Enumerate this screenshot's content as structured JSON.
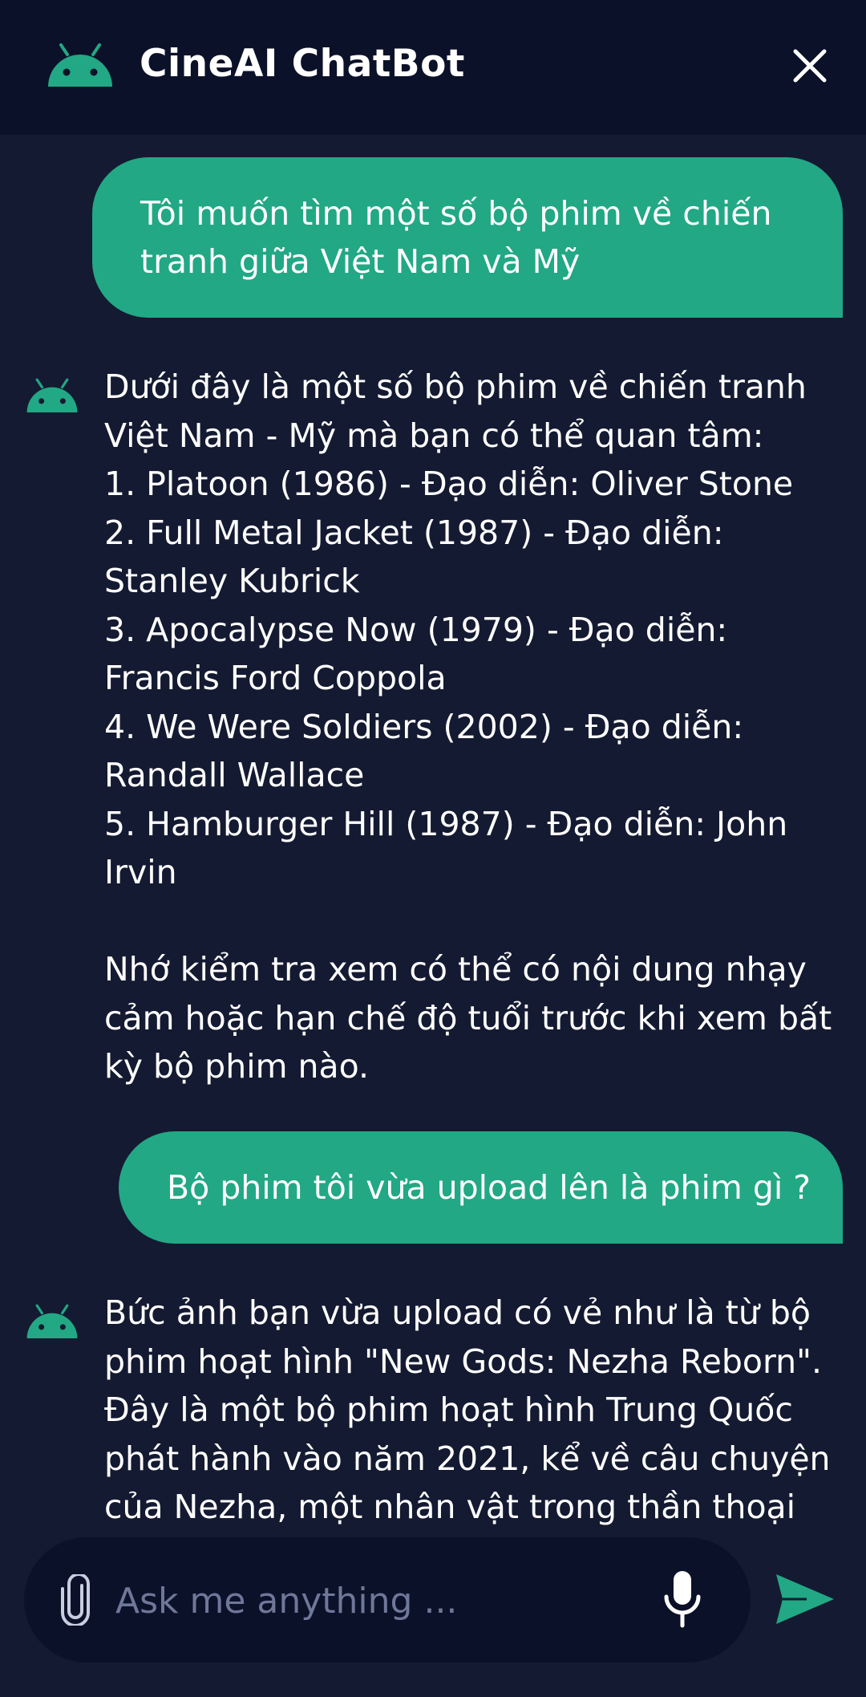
{
  "header": {
    "title": "CineAI ChatBot",
    "bot_icon": "android-icon",
    "close_icon": "close-icon"
  },
  "messages": [
    {
      "role": "user",
      "text": "Tôi muốn tìm một số bộ phim về chiến\ntranh giữa Việt Nam và Mỹ"
    },
    {
      "role": "bot",
      "text": "Dưới đây là một số bộ phim về chiến tranh\nViệt Nam - Mỹ mà bạn có thể quan tâm:\n1. Platoon (1986) - Đạo diễn: Oliver Stone\n2. Full Metal Jacket (1987) - Đạo diễn:\nStanley Kubrick\n3. Apocalypse Now (1979) - Đạo diễn:\nFrancis Ford Coppola\n4. We Were Soldiers (2002) - Đạo diễn:\nRandall Wallace\n5. Hamburger Hill (1987) - Đạo diễn: John\nIrvin\n\nNhớ kiểm tra xem có thể có nội dung nhạy\ncảm hoặc hạn chế độ tuổi trước khi xem bất\nkỳ bộ phim nào."
    },
    {
      "role": "user",
      "text": "Bộ phim tôi vừa upload lên là phim gì ?"
    },
    {
      "role": "bot",
      "text": "Bức ảnh bạn vừa upload có vẻ như là từ bộ\nphim hoạt hình \"New Gods: Nezha Reborn\".\nĐây là một bộ phim hoạt hình Trung Quốc\nphát hành vào năm 2021, kể về câu chuyện\ncủa Nezha, một nhân vật trong thần thoại"
    }
  ],
  "input": {
    "placeholder": "Ask me anything ...",
    "value": "",
    "attach_icon": "paperclip-icon",
    "mic_icon": "microphone-icon",
    "send_icon": "send-icon"
  },
  "colors": {
    "background": "#141a31",
    "header": "#0b1128",
    "accent": "#22a884",
    "placeholder": "#6f7899"
  }
}
